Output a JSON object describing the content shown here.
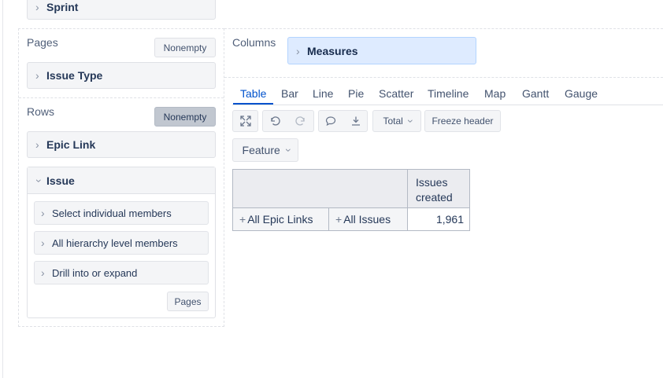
{
  "sidebar": {
    "sprint_label": "Sprint",
    "pages": {
      "title": "Pages",
      "nonempty_label": "Nonempty",
      "dimension": "Issue Type"
    },
    "rows": {
      "title": "Rows",
      "nonempty_label": "Nonempty",
      "epic_link": "Epic Link",
      "issue": "Issue",
      "issue_options": [
        "Select individual members",
        "All hierarchy level members",
        "Drill into or expand"
      ],
      "pages_button": "Pages"
    }
  },
  "columns": {
    "title": "Columns",
    "dimension": "Measures"
  },
  "tabs": [
    "Table",
    "Bar",
    "Line",
    "Pie",
    "Scatter",
    "Timeline",
    "Map",
    "Gantt",
    "Gauge"
  ],
  "active_tab": "Table",
  "toolbar": {
    "total_label": "Total",
    "freeze_header_label": "Freeze header",
    "feature_label": "Feature"
  },
  "icons": {
    "expand": "expand-icon",
    "undo": "undo-icon",
    "redo": "redo-icon",
    "comment": "comment-icon",
    "download": "download-icon"
  },
  "table": {
    "header": "Issues created",
    "row": {
      "epic": "All Epic Links",
      "issue": "All Issues",
      "value": "1,961"
    }
  },
  "colors": {
    "accent": "#0052cc",
    "columns_drop_bg": "#deebff",
    "nonempty_active_bg": "#c1c7d0"
  }
}
